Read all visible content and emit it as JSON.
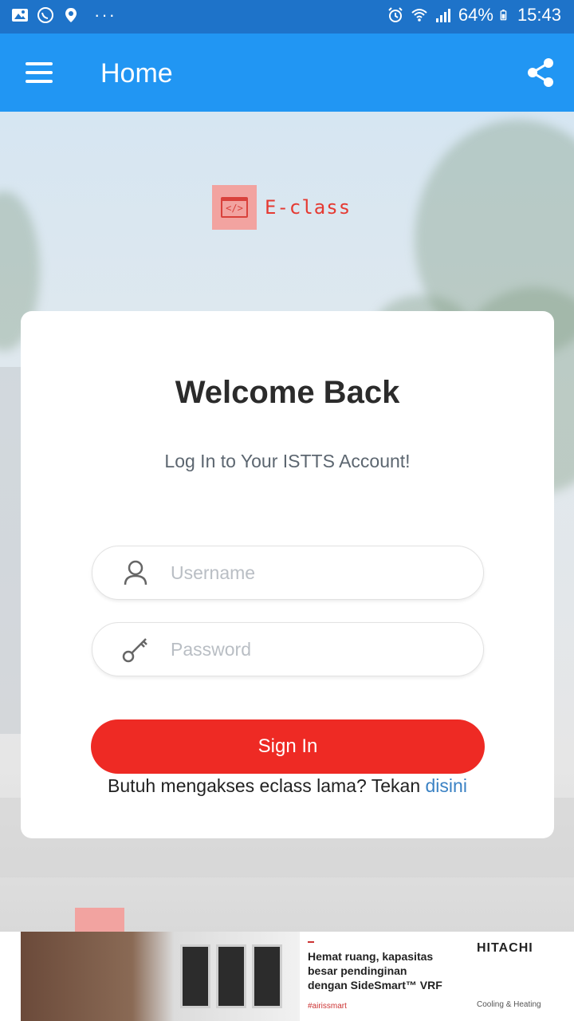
{
  "status_bar": {
    "battery": "64%",
    "time": "15:43",
    "left_icons": [
      "gallery-icon",
      "whatsapp-icon",
      "location-icon",
      "more-dots-icon"
    ],
    "right_icons": [
      "alarm-icon",
      "wifi-icon",
      "signal-icon",
      "battery-icon"
    ]
  },
  "app_bar": {
    "title": "Home",
    "menu_icon": "hamburger-menu-icon",
    "share_icon": "share-icon"
  },
  "logo": {
    "text": "E-class",
    "glyph": "</>"
  },
  "login": {
    "heading": "Welcome Back",
    "subtitle": "Log In to Your ISTTS Account!",
    "username_placeholder": "Username",
    "username_value": "",
    "password_placeholder": "Password",
    "password_value": "",
    "signin_label": "Sign In",
    "legacy_text": "Butuh mengakses eclass lama? Tekan ",
    "legacy_link": "disini"
  },
  "ad": {
    "headline_line1": "Hemat ruang, kapasitas",
    "headline_line2": "besar pendinginan",
    "headline_line3": "dengan SideSmart™ VRF",
    "hashtag": "#airissmart",
    "brand": "HITACHI",
    "brand_sub": "Cooling & Heating"
  },
  "colors": {
    "status_bar": "#1e73c9",
    "app_bar": "#2196f3",
    "accent_red": "#ee2a24",
    "link_blue": "#3b82c4",
    "logo_pink": "#f2a3a0"
  }
}
